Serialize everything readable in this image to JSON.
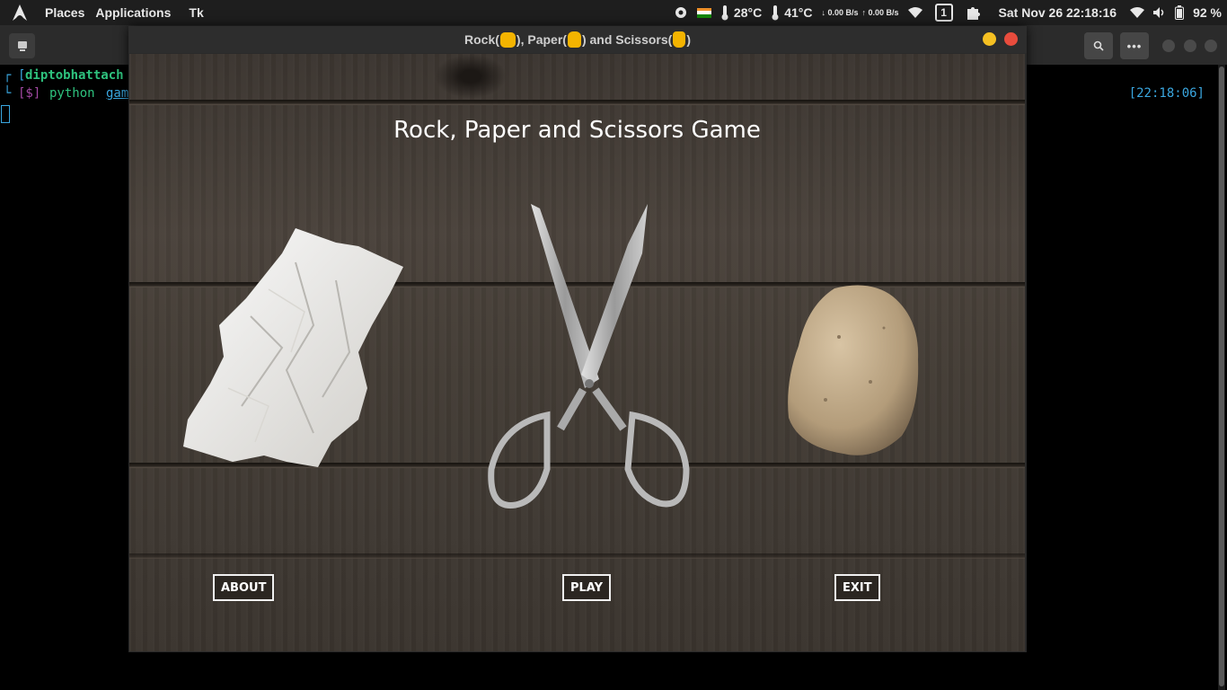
{
  "topbar": {
    "menus": [
      "Places",
      "Applications",
      "Tk"
    ],
    "cpu_temp": "28°C",
    "gpu_temp": "41°C",
    "net_down": "↓ 0.00 B/s",
    "net_up": "↑ 0.00 B/s",
    "workspace": "1",
    "datetime": "Sat Nov 26  22:18:16",
    "battery": "92 %"
  },
  "terminal": {
    "user": "diptobhattach",
    "prompt": "[$]",
    "command": "python",
    "arg": "gam",
    "time": "[22:18:06]"
  },
  "window": {
    "title_prefix": "Rock(",
    "title_mid1": "), Paper(",
    "title_mid2": ") and Scissors(",
    "title_suffix": ")"
  },
  "game": {
    "title": "Rock, Paper and Scissors Game",
    "buttons": {
      "about": "ABOUT",
      "play": "PLAY",
      "exit": "EXIT"
    }
  }
}
